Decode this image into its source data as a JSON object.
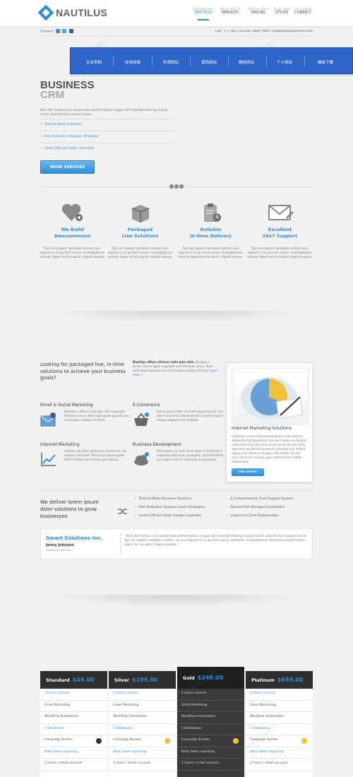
{
  "logo": {
    "name": "NAUTILUS"
  },
  "nav": [
    {
      "sub": "Welcome home",
      "label": "NAUTILUS",
      "active": true
    },
    {
      "sub": "We are best at",
      "label": "SERVICES"
    },
    {
      "sub": "Package offered",
      "label": "PRICING"
    },
    {
      "sub": "Single page",
      "label": "STYLES"
    },
    {
      "sub": "Get in touch",
      "label": "CONTACT"
    }
  ],
  "subbar": {
    "connect": "Connect",
    "contact": "Call: + 1 (00) 123 456 7890 | Mail: mail@companyname.com"
  },
  "banner": {
    "items": [
      "企业官网",
      "在线商城",
      "外贸网站",
      "源码网站",
      "微信网站",
      "个人网站",
      "模板下载"
    ]
  },
  "hero": {
    "title": "BUSINESS",
    "subtitle": "CRM",
    "text": "Nam liber tempor cum soluta nobis eleifend option congue nihil imperdiet doming id quod mazim placerat facer possim assum.",
    "list": [
      "Tailored Made Solutions",
      "Risk Reduction Quisque Strategies",
      "Lorem Efficient Dolor Imperdiet"
    ],
    "button": "MORE SERVICES"
  },
  "features": [
    {
      "title": "We Build\nAwesomeness",
      "icon": "heart-gear-icon",
      "desc": "Typi non habent claritatem insitam usus legentis in iis qui facit eorum. Investigationes lectores legere me lius quod ii legunt saepius."
    },
    {
      "title": "Packaged\nLive Solutions",
      "icon": "package-icon",
      "desc": "Typi non habent claritatem insitam usus legentis in iis qui facit eorum. Investigationes lectores legere me lius quod ii legunt saepius."
    },
    {
      "title": "Reliable\nIn-time Delivery",
      "icon": "clipboard-clock-icon",
      "desc": "Typi non habent claritatem insitam usus legentis in iis qui facit eorum. Investigationes lectores legere me lius quod ii legunt saepius."
    },
    {
      "title": "Excellent\n24x7 Support",
      "icon": "envelope-icon",
      "desc": "Typi non habent claritatem insitam usus legentis in iis qui facit eorum. Investigationes lectores legere me lius quod ii legunt saepius."
    }
  ],
  "intro": {
    "heading": "Looking for packaged live, in-time solutions to achieve your business goals?",
    "bold": "Nautilus offers ultrices nulla quis nibh.",
    "text": "Quisque a lectus. Donec ligula vulputate sem tristique cursus. Nam nulla quam gravida non, commodo a sodales sit ame.",
    "link": "Learn more »"
  },
  "services": [
    {
      "title": "Email & Social Marketing",
      "icon": "email-social-icon",
      "desc": "Phasellus ultrices nulla quis nibh vulputate tristique cursus. Nam nulla quam gravida non, commodo a sodales sit amet."
    },
    {
      "title": "E-Commerce",
      "icon": "basket-icon",
      "desc": "Lorem ipsum dolor sit amet adipiscing elit, sed diam nonummy nibh euismod ut laoreet dolore magna aliquam erat volutpat."
    },
    {
      "title": "Internet Marketing",
      "icon": "chart-icon",
      "desc": "Claritas est etiam processus dynamicus, qui sequitur lectorum. Mirum est notare quam littera formas humanitatis per seacula."
    },
    {
      "title": "Business Development",
      "icon": "cloud-icon",
      "desc": "Duis autem vel eum iriure dolor in hendrerit in vulputate velit esse consequat, vel illum dolore eu feugiat nulla et iusto odio qui praesent."
    }
  ],
  "card": {
    "title": "Internet Marketing Solutions",
    "desc": "Creating a successful marketing plan that attracts awesome lead generation vel illum dolore eu feugiat nulla facilisis at vero eros et accumsan et iusto odio dignissim qui blandit praesent luptatum zzril delenit augue duis dolore te feugait nulla facilisi. Ut wisi enim ad minim veniam, quis nostrud exerci tation ullamcorper.",
    "button": "FREE REPORT"
  },
  "deliver": {
    "heading": "We deliver lorem ipsum dolor solutions to grow businesses",
    "col1": [
      "Tailored Made Business Solutions",
      "Risk Reduction Quisque Lorem Strategies",
      "Lorem Efficient Dolor Integer Imperdiet"
    ],
    "col2": [
      "A Comprehensive Trust Support System",
      "Tailored Risk Managed Investment",
      "Long-term Client Relationships"
    ]
  },
  "testimonial": {
    "company": "Smart Solutions Inc.",
    "person": "Jenny Johnson",
    "role": "Marketing Executive",
    "quote": "\" Nam liber tempor cum soluta nobis eleifend option congue nihil imperdiet doming id quod mazim placerat facer possim assum. Typi non habent claritatem insitam; est usus legentis in iis qui facit eorum claritatem. Investigationes demonstraverunt lectores legere me lius quod ii legunt saepius. \""
  },
  "pricing": [
    {
      "name": "Standard",
      "price": "49.00",
      "rows": [
        "2 Users License",
        "Email Marketing",
        "Workflow Automation",
        "5 Databases",
        "Campaign Builder",
        "Daily Sales reporting",
        "2 Users / email account"
      ]
    },
    {
      "name": "Silver",
      "price": "199.00",
      "rows": [
        "2 Users License",
        "Email Marketing",
        "Workflow Automation",
        "5 Databases",
        "Campaign Builder",
        "Daily Sales reporting",
        "2 Users / email account"
      ]
    },
    {
      "name": "Gold",
      "price": "249.00",
      "rows": [
        "2 Users License",
        "Email Marketing",
        "Workflow Automation",
        "5 Databases",
        "Campaign Builder",
        "Daily Sales reporting",
        "2 Users / email account"
      ]
    },
    {
      "name": "Platinum",
      "price": "659.00",
      "rows": [
        "2 Users License",
        "Email Marketing",
        "Workflow Automation",
        "5 Databases",
        "Campaign Builder",
        "Daily Sales reporting",
        "2 Users / email account"
      ]
    }
  ],
  "currency": "$",
  "watermark": "webmoban",
  "colors": {
    "accent": "#2d8ed6",
    "banner": "#2f65c9",
    "dark": "#2e2e2e"
  }
}
